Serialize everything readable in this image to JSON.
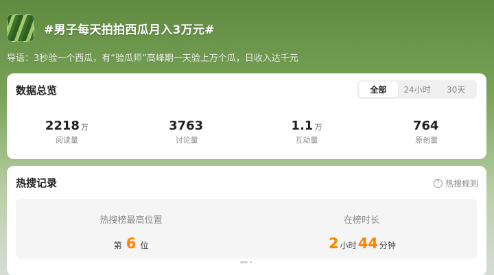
{
  "header": {
    "title": "#男子每天拍拍西瓜月入3万元#",
    "thumbnail_icon": "watermelon-thumbnail"
  },
  "intro": "导语：3秒验一个西瓜，有“验瓜师”高峰期一天验上万个瓜，日收入达千元",
  "overview": {
    "title": "数据总览",
    "tabs": [
      {
        "label": "全部",
        "active": true
      },
      {
        "label": "24小时",
        "active": false
      },
      {
        "label": "30天",
        "active": false
      }
    ],
    "stats": [
      {
        "value": "2218",
        "unit": "万",
        "label": "阅读量"
      },
      {
        "value": "3763",
        "unit": "",
        "label": "讨论量"
      },
      {
        "value": "1.1",
        "unit": "万",
        "label": "互动量"
      },
      {
        "value": "764",
        "unit": "",
        "label": "原创量"
      }
    ]
  },
  "hot": {
    "title": "热搜记录",
    "rules_label": "热搜规则",
    "rules_icon": "question-circle-icon",
    "peak": {
      "label": "热搜榜最高位置",
      "prefix": "第",
      "value": "6",
      "suffix": "位"
    },
    "duration": {
      "label": "在榜时长",
      "hours": "2",
      "hours_unit": "小时",
      "minutes": "44",
      "minutes_unit": "分钟"
    }
  },
  "colors": {
    "accent": "#ff8200",
    "card_bg": "#ffffff"
  }
}
